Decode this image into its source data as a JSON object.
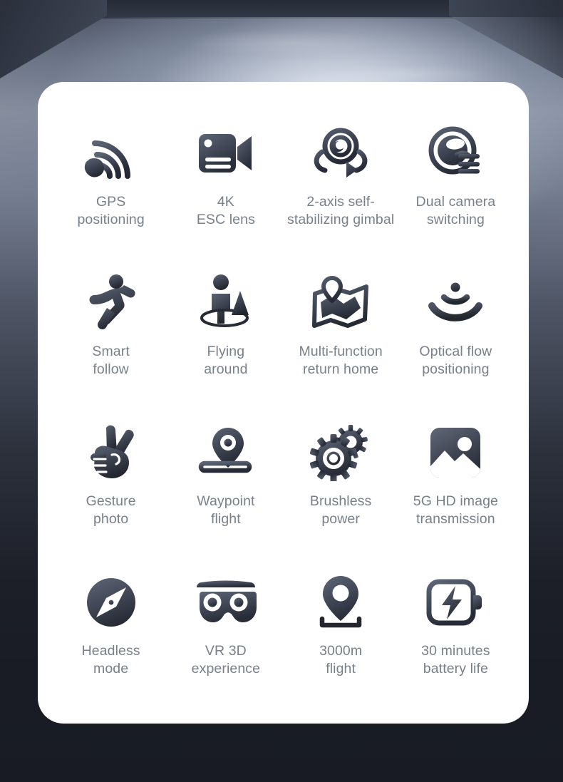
{
  "background": {
    "description": "concrete industrial room with lit floor",
    "wall_color": "#2e3440",
    "floor_light_color": "#eef2f8",
    "bottom_color": "#181b23"
  },
  "card": {
    "background_color": "#ffffff",
    "corner_radius_px": 36
  },
  "style": {
    "label_color": "#78808a",
    "icon_gradient_from": "#555d6e",
    "icon_gradient_to": "#2a2e3a"
  },
  "features": [
    {
      "icon": "gps-signal-icon",
      "label": "GPS\npositioning"
    },
    {
      "icon": "video-camera-icon",
      "label": "4K\nESC lens"
    },
    {
      "icon": "gimbal-rotation-icon",
      "label": "2-axis self-\nstabilizing gimbal"
    },
    {
      "icon": "dual-camera-icon",
      "label": "Dual camera\nswitching"
    },
    {
      "icon": "running-person-icon",
      "label": "Smart\nfollow"
    },
    {
      "icon": "orbit-person-icon",
      "label": "Flying\naround"
    },
    {
      "icon": "map-pin-fold-icon",
      "label": "Multi-function\nreturn home"
    },
    {
      "icon": "optical-flow-waves-icon",
      "label": "Optical flow\npositioning"
    },
    {
      "icon": "hand-peace-icon",
      "label": "Gesture\nphoto"
    },
    {
      "icon": "waypoint-path-icon",
      "label": "Waypoint\nflight"
    },
    {
      "icon": "double-gear-icon",
      "label": "Brushless\npower"
    },
    {
      "icon": "photo-image-icon",
      "label": "5G HD image\ntransmission"
    },
    {
      "icon": "compass-icon",
      "label": "Headless\nmode"
    },
    {
      "icon": "vr-goggles-icon",
      "label": "VR 3D\nexperience"
    },
    {
      "icon": "location-pin-range-icon",
      "label": "3000m\nflight"
    },
    {
      "icon": "battery-bolt-icon",
      "label": "30 minutes\nbattery life"
    }
  ]
}
